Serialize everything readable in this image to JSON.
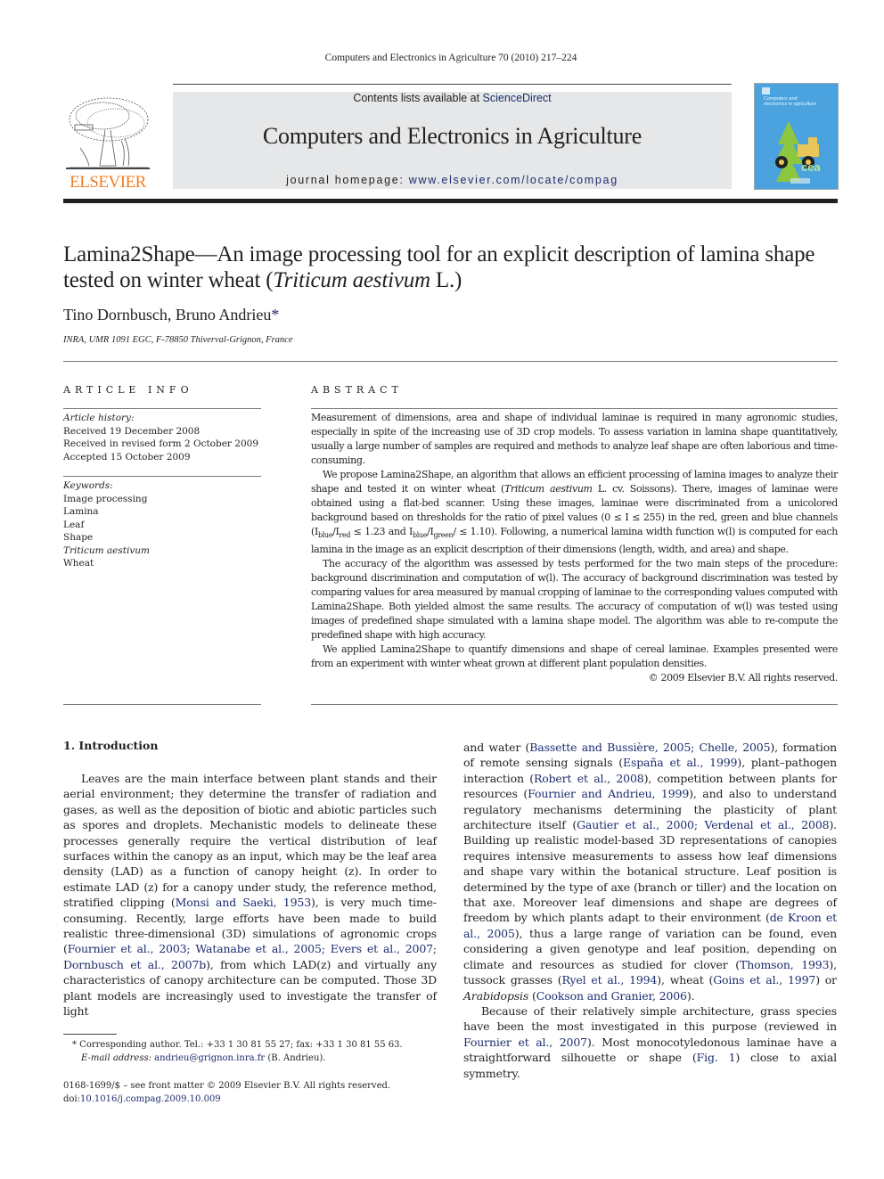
{
  "running_header": "Computers and Electronics in Agriculture 70 (2010) 217–224",
  "masthead": {
    "contents_prefix": "Contents lists available at ",
    "contents_link": "ScienceDirect",
    "journal_title": "Computers and Electronics in Agriculture",
    "homepage_prefix": "journal homepage: ",
    "homepage_link": "www.elsevier.com/locate/compag",
    "publisher_logo_text": "ELSEVIER",
    "publisher_logo_icon": "tree-engraving-icon",
    "cover_title": "Computers and electronics in agriculture",
    "cover_badge": "cea",
    "colors": {
      "elsevier_orange": "#f07e26",
      "link_blue": "#1d2d6e",
      "masthead_gray": "#e6e7e8",
      "cover_blue": "#4aa3de"
    }
  },
  "article": {
    "title_part1": "Lamina2Shape—An image processing tool for an explicit description of lamina shape tested on winter wheat (",
    "title_italic": "Triticum aestivum",
    "title_part2": " L.)",
    "authors": "Tino Dornbusch, Bruno Andrieu",
    "author_mark": "*",
    "affiliation": "INRA, UMR 1091 EGC, F-78850 Thiverval-Grignon, France"
  },
  "article_info": {
    "heading": "ARTICLE INFO",
    "history_label": "Article history:",
    "history": [
      "Received 19 December 2008",
      "Received in revised form 2 October 2009",
      "Accepted 15 October 2009"
    ],
    "keywords_label": "Keywords:",
    "keywords": [
      "Image processing",
      "Lamina",
      "Leaf",
      "Shape",
      "Triticum aestivum",
      "Wheat"
    ]
  },
  "abstract": {
    "heading": "ABSTRACT",
    "p1": "Measurement of dimensions, area and shape of individual laminae is required in many agronomic studies, especially in spite of the increasing use of 3D crop models. To assess variation in lamina shape quantitatively, usually a large number of samples are required and methods to analyze leaf shape are often laborious and time-consuming.",
    "p2_a": "We propose Lamina2Shape, an algorithm that allows an efficient processing of lamina images to analyze their shape and tested it on winter wheat (",
    "p2_italic": "Triticum aestivum",
    "p2_b": " L. cv. Soissons). There, images of laminae were obtained using a flat-bed scanner. Using these images, laminae were discriminated from a unicolored background based on thresholds for the ratio of pixel values (0 ≤ I ≤ 255) in the red, green and blue channels (I",
    "p2_sub1": "blue",
    "p2_c": "/I",
    "p2_sub2": "red",
    "p2_d": " ≤ 1.23 and I",
    "p2_sub3": "blue",
    "p2_e": "/I",
    "p2_sub4": "green",
    "p2_f": "/ ≤ 1.10). Following, a numerical lamina width function w(l) is computed for each lamina in the image as an explicit description of their dimensions (length, width, and area) and shape.",
    "p3": "The accuracy of the algorithm was assessed by tests performed for the two main steps of the procedure: background discrimination and computation of w(l). The accuracy of background discrimination was tested by comparing values for area measured by manual cropping of laminae to the corresponding values computed with Lamina2Shape. Both yielded almost the same results. The accuracy of computation of w(l) was tested using images of predefined shape simulated with a lamina shape model. The algorithm was able to re-compute the predefined shape with high accuracy.",
    "p4": "We applied Lamina2Shape to quantify dimensions and shape of cereal laminae. Examples presented were from an experiment with winter wheat grown at different plant population densities.",
    "copyright": "© 2009 Elsevier B.V. All rights reserved."
  },
  "introduction": {
    "heading": "1.  Introduction",
    "left": {
      "t1": "Leaves are the main interface between plant stands and their aerial environment; they determine the transfer of radiation and gases, as well as the deposition of biotic and abiotic particles such as spores and droplets. Mechanistic models to delineate these processes generally require the vertical distribution of leaf surfaces within the canopy as an input, which may be the leaf area density (LAD) as a function of canopy height (z). In order to estimate LAD (z) for a canopy under study, the reference method, stratified clipping (",
      "c1": "Monsi and Saeki, 1953",
      "t2": "), is very much time-consuming. Recently, large efforts have been made to build realistic three-dimensional (3D) simulations of agronomic crops (",
      "c2": "Fournier et al., 2003; Watanabe et al., 2005; Evers et al., 2007; Dornbusch et al., 2007b",
      "t3": "), from which LAD(z) and virtually any characteristics of canopy architecture can be computed. Those 3D plant models are increasingly used to investigate the transfer of light"
    },
    "right": {
      "t1": "and water (",
      "c1": "Bassette and Bussière, 2005; Chelle, 2005",
      "t2": "), formation of remote sensing signals (",
      "c2": "España et al., 1999",
      "t3": "), plant–pathogen interaction (",
      "c3": "Robert et al., 2008",
      "t4": "), competition between plants for resources (",
      "c4": "Fournier and Andrieu, 1999",
      "t5": "), and also to understand regulatory mechanisms determining the plasticity of plant architecture itself (",
      "c5": "Gautier et al., 2000; Verdenal et al., 2008",
      "t6": "). Building up realistic model-based 3D representations of canopies requires intensive measurements to assess how leaf dimensions and shape vary within the botanical structure. Leaf position is determined by the type of axe (branch or tiller) and the location on that axe. Moreover leaf dimensions and shape are degrees of freedom by which plants adapt to their environment (",
      "c6": "de Kroon et al., 2005",
      "t7": "), thus a large range of variation can be found, even considering a given genotype and leaf position, depending on climate and resources as studied for clover (",
      "c7": "Thomson, 1993",
      "t8": "), tussock grasses (",
      "c8": "Ryel et al., 1994",
      "t9": "), wheat (",
      "c9": "Goins et al., 1997",
      "t10": ") or ",
      "i10": "Arabidopsis",
      "t11": " (",
      "c11": "Cookson and Granier, 2006",
      "t12": ").",
      "p2_t1": "Because of their relatively simple architecture, grass species have been the most investigated in this purpose (reviewed in ",
      "p2_c1": "Fournier et al., 2007",
      "p2_t2": "). Most monocotyledonous laminae have a straightforward silhouette or shape (",
      "p2_c2": "Fig. 1",
      "p2_t3": ") close to axial symmetry."
    }
  },
  "footnote": {
    "marker": "*",
    "text": " Corresponding author. Tel.: +33 1 30 81 55 27; fax: +33 1 30 81 55 63.",
    "email_label": "E-mail address:",
    "email": "andrieu@grignon.inra.fr",
    "email_suffix": " (B. Andrieu)."
  },
  "front_matter": {
    "issn_line": "0168-1699/$ – see front matter © 2009 Elsevier B.V. All rights reserved.",
    "doi_prefix": "doi:",
    "doi": "10.1016/j.compag.2009.10.009"
  }
}
